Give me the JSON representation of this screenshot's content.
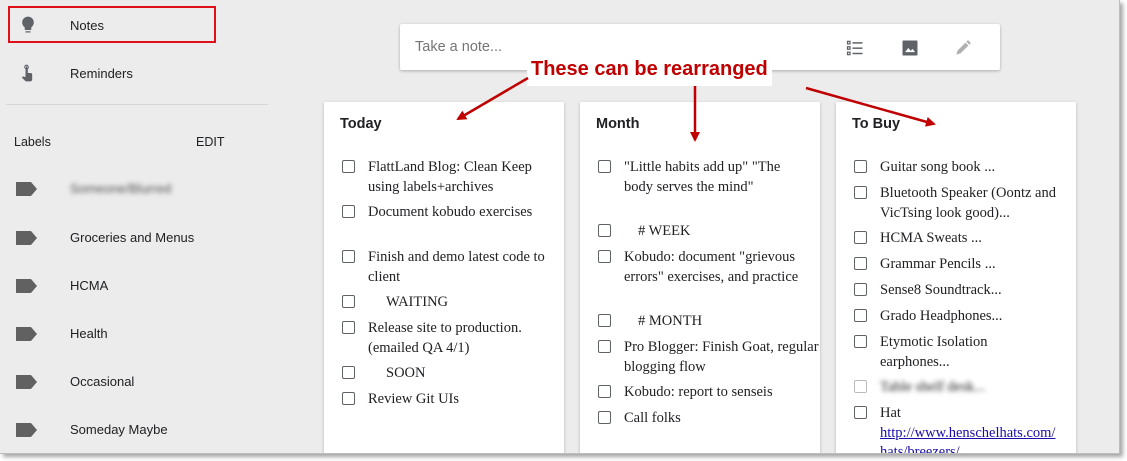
{
  "sidebar": {
    "notes_label": "Notes",
    "reminders_label": "Reminders",
    "labels_heading": "Labels",
    "edit_label": "EDIT",
    "labels": [
      {
        "label": "Someone/Blurred",
        "blurred": true
      },
      {
        "label": "Groceries and Menus"
      },
      {
        "label": "HCMA"
      },
      {
        "label": "Health"
      },
      {
        "label": "Occasional"
      },
      {
        "label": "Someday Maybe"
      }
    ]
  },
  "take_note": {
    "placeholder": "Take a note..."
  },
  "annotation": {
    "text": "These can be rearranged",
    "color": "#c00000"
  },
  "columns": [
    {
      "title": "Today",
      "items": [
        {
          "text": "FlattLand Blog: Clean Keep using labels+archives"
        },
        {
          "text": "Document kobudo exercises"
        },
        {
          "text": "Finish and demo latest code to client"
        },
        {
          "text": "WAITING",
          "section": true
        },
        {
          "text": "Release site to production. (emailed QA 4/1)"
        },
        {
          "text": "SOON",
          "section": true
        },
        {
          "text": "Review Git UIs"
        }
      ]
    },
    {
      "title": "Month",
      "items": [
        {
          "text": "\"Little habits add up\" \"The body serves the mind\""
        },
        {
          "text": "# WEEK",
          "section": true
        },
        {
          "text": "Kobudo: document \"grievous errors\" exercises, and practice"
        },
        {
          "text": "# MONTH",
          "section": true
        },
        {
          "text": "Pro Blogger: Finish Goat, regular blogging flow"
        },
        {
          "text": "Kobudo: report to senseis"
        },
        {
          "text": "Call folks"
        }
      ]
    },
    {
      "title": "To Buy",
      "items": [
        {
          "text": "Guitar song book ..."
        },
        {
          "text": "Bluetooth Speaker (Oontz and VicTsing look good)..."
        },
        {
          "text": "HCMA Sweats ..."
        },
        {
          "text": "Grammar Pencils ..."
        },
        {
          "text": "Sense8 Soundtrack..."
        },
        {
          "text": "Grado Headphones..."
        },
        {
          "text": "Etymotic Isolation earphones..."
        },
        {
          "text": "Table shelf desk...",
          "blurred": true
        },
        {
          "text": "Hat"
        },
        {
          "text": "http://www.henschelhats.com/hats/breezers/",
          "link": true
        }
      ]
    }
  ],
  "colors": {
    "highlight": "#e0101a",
    "background": "#ececec",
    "link": "#1a0dab"
  }
}
